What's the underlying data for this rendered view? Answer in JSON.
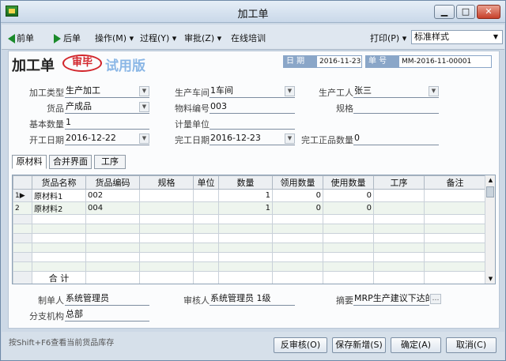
{
  "window": {
    "title": "加工单"
  },
  "toolbar": {
    "prev": "前单",
    "next": "后单",
    "operate": "操作(M) ▾",
    "process": "过程(Y) ▾",
    "approve": "审批(Z) ▾",
    "training": "在线培训",
    "print": "打印(P) ▾",
    "style_value": "标准样式"
  },
  "header": {
    "doc_title": "加工单",
    "stamp": "审毕",
    "trial": "试用版",
    "date_label": "日 期",
    "date_value": "2016-11-23",
    "number_label": "单 号",
    "number_value": "MM-2016-11-00001"
  },
  "fields": {
    "process_type_label": "加工类型",
    "process_type": "生产加工",
    "workshop_label": "生产车间",
    "workshop": "1车间",
    "worker_label": "生产工人",
    "worker": "张三",
    "product_label": "货品",
    "product": "产成品",
    "material_no_label": "物料编号",
    "material_no": "003",
    "spec_label": "规格",
    "spec": "",
    "base_qty_label": "基本数量",
    "base_qty": "1",
    "unit_label": "计量单位",
    "unit": "",
    "start_date_label": "开工日期",
    "start_date": "2016-12-22",
    "finish_date_label": "完工日期",
    "finish_date": "2016-12-23",
    "finished_qty_label": "完工正品数量",
    "finished_qty": "0"
  },
  "tabs": [
    "原材料",
    "合并界面",
    "工序"
  ],
  "grid": {
    "columns": [
      "货品名称",
      "货品编码",
      "规格",
      "单位",
      "数量",
      "领用数量",
      "使用数量",
      "工序",
      "备注"
    ],
    "rows": [
      {
        "idx": "1▶",
        "name": "原材料1",
        "code": "002",
        "spec": "",
        "unit": "",
        "qty": "1",
        "taken": "0",
        "used": "0",
        "process": "",
        "note": ""
      },
      {
        "idx": "2",
        "name": "原材料2",
        "code": "004",
        "spec": "",
        "unit": "",
        "qty": "1",
        "taken": "0",
        "used": "0",
        "process": "",
        "note": ""
      }
    ],
    "total_label": "合 计"
  },
  "footer": {
    "creator_label": "制单人",
    "creator": "系统管理员",
    "reviewer_label": "审核人",
    "reviewer": "系统管理员 1级",
    "summary_label": "摘要",
    "summary": "MRP生产建议下达的",
    "branch_label": "分支机构",
    "branch": "总部"
  },
  "status": {
    "hint": "按Shift+F6查看当前货品库存",
    "unaudit": "反审核(O)",
    "save_new": "保存新增(S)",
    "ok": "确定(A)",
    "cancel": "取消(C)"
  }
}
